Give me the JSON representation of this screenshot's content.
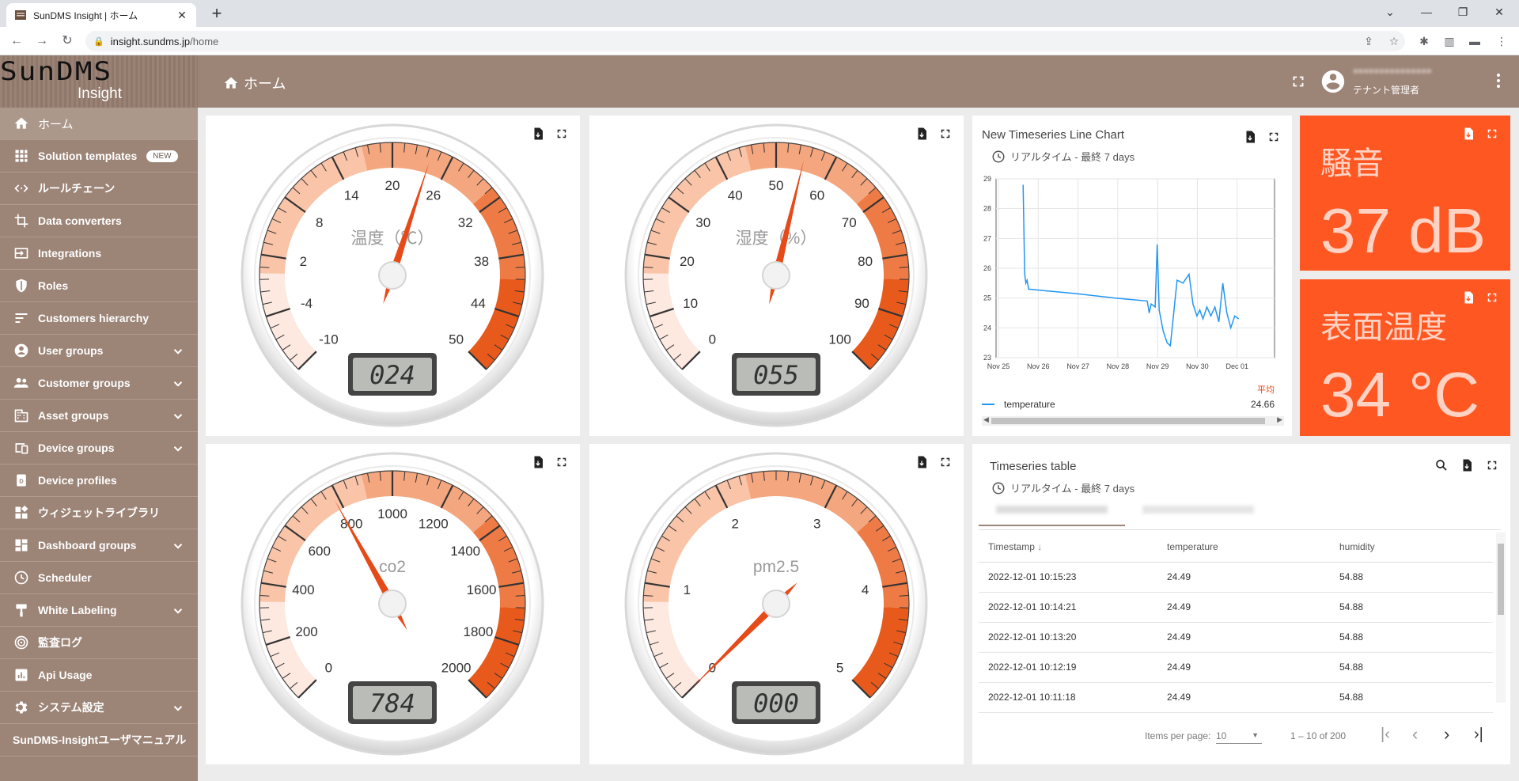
{
  "browser": {
    "tab_title": "SunDMS Insight | ホーム",
    "url_host": "insight.sundms.jp",
    "url_path": "/home"
  },
  "logo": {
    "main": "SunDMS",
    "sub": "Insight"
  },
  "sidebar": {
    "items": [
      {
        "label": "ホーム",
        "icon": "home-icon"
      },
      {
        "label": "Solution templates",
        "icon": "grid-icon",
        "badge": "NEW"
      },
      {
        "label": "ルールチェーン",
        "icon": "code-icon"
      },
      {
        "label": "Data converters",
        "icon": "crop-icon"
      },
      {
        "label": "Integrations",
        "icon": "input-icon"
      },
      {
        "label": "Roles",
        "icon": "shield-icon"
      },
      {
        "label": "Customers hierarchy",
        "icon": "sort-icon"
      },
      {
        "label": "User groups",
        "icon": "account-icon",
        "chevron": true
      },
      {
        "label": "Customer groups",
        "icon": "people-icon",
        "chevron": true
      },
      {
        "label": "Asset groups",
        "icon": "building-icon",
        "chevron": true
      },
      {
        "label": "Device groups",
        "icon": "devices-icon",
        "chevron": true
      },
      {
        "label": "Device profiles",
        "icon": "profile-icon"
      },
      {
        "label": "ウィジェットライブラリ",
        "icon": "widgets-icon"
      },
      {
        "label": "Dashboard groups",
        "icon": "dashboard-icon",
        "chevron": true
      },
      {
        "label": "Scheduler",
        "icon": "clock-icon"
      },
      {
        "label": "White Labeling",
        "icon": "brush-icon",
        "chevron": true
      },
      {
        "label": "監査ログ",
        "icon": "track-icon"
      },
      {
        "label": "Api Usage",
        "icon": "chart-icon"
      },
      {
        "label": "システム設定",
        "icon": "gear-icon",
        "chevron": true
      },
      {
        "label": "SunDMS-Insightユーザマニュアル",
        "icon": ""
      }
    ]
  },
  "topbar": {
    "breadcrumb": "ホーム",
    "user_role": "テナント管理者"
  },
  "gauges": [
    {
      "title": "温度（℃）",
      "min": -10,
      "max": 50,
      "ticks": [
        -10,
        -4,
        2,
        8,
        14,
        20,
        26,
        32,
        38,
        44,
        50
      ],
      "value": 24,
      "display": "024"
    },
    {
      "title": "湿度（%）",
      "min": 0,
      "max": 100,
      "ticks": [
        0,
        10,
        20,
        30,
        40,
        50,
        60,
        70,
        80,
        90,
        100
      ],
      "value": 55,
      "display": "055"
    },
    {
      "title": "co2",
      "min": 0,
      "max": 2000,
      "ticks": [
        0,
        200,
        400,
        600,
        800,
        1000,
        1200,
        1400,
        1600,
        1800,
        2000
      ],
      "value": 784,
      "display": "784"
    },
    {
      "title": "pm2.5",
      "min": 0,
      "max": 5,
      "ticks": [
        0,
        1,
        2,
        3,
        4,
        5
      ],
      "value": 0,
      "display": "000"
    }
  ],
  "line_chart": {
    "title": "New Timeseries Line Chart",
    "timewindow": "リアルタイム - 最終 7 days",
    "avg_label": "平均",
    "legend_name": "temperature",
    "legend_avg": "24.66"
  },
  "chart_data": {
    "type": "line",
    "x_labels": [
      "Nov 25",
      "Nov 26",
      "Nov 27",
      "Nov 28",
      "Nov 29",
      "Nov 30",
      "Dec 01"
    ],
    "ylim": [
      23,
      29
    ],
    "yticks": [
      23,
      24,
      25,
      26,
      27,
      28,
      29
    ],
    "grid": true,
    "legend": "bottom",
    "series": [
      {
        "name": "temperature",
        "color": "#2196f3",
        "points": [
          [
            0.68,
            28.8
          ],
          [
            0.72,
            25.8
          ],
          [
            0.75,
            25.5
          ],
          [
            0.78,
            25.6
          ],
          [
            0.82,
            25.3
          ],
          [
            1.2,
            25.25
          ],
          [
            2.0,
            25.15
          ],
          [
            3.0,
            25.0
          ],
          [
            3.8,
            24.9
          ],
          [
            3.85,
            24.5
          ],
          [
            3.9,
            24.8
          ],
          [
            4.0,
            24.7
          ],
          [
            4.05,
            26.8
          ],
          [
            4.1,
            24.6
          ],
          [
            4.2,
            23.9
          ],
          [
            4.3,
            23.5
          ],
          [
            4.38,
            23.4
          ],
          [
            4.45,
            24.3
          ],
          [
            4.55,
            25.6
          ],
          [
            4.7,
            25.5
          ],
          [
            4.85,
            25.8
          ],
          [
            4.95,
            24.8
          ],
          [
            5.05,
            24.4
          ],
          [
            5.12,
            24.6
          ],
          [
            5.2,
            24.3
          ],
          [
            5.3,
            24.7
          ],
          [
            5.4,
            24.4
          ],
          [
            5.5,
            24.7
          ],
          [
            5.6,
            24.2
          ],
          [
            5.7,
            25.5
          ],
          [
            5.8,
            24.5
          ],
          [
            5.9,
            24.0
          ],
          [
            6.0,
            24.4
          ],
          [
            6.1,
            24.3
          ]
        ]
      }
    ]
  },
  "noise": {
    "title": "騒音",
    "value": "37 dB"
  },
  "surface_temp": {
    "title": "表面温度",
    "value": "34 °C"
  },
  "ts_table": {
    "title": "Timeseries table",
    "timewindow": "リアルタイム - 最終 7 days",
    "columns": [
      "Timestamp",
      "temperature",
      "humidity"
    ],
    "rows": [
      [
        "2022-12-01 10:15:23",
        "24.49",
        "54.88"
      ],
      [
        "2022-12-01 10:14:21",
        "24.49",
        "54.88"
      ],
      [
        "2022-12-01 10:13:20",
        "24.49",
        "54.88"
      ],
      [
        "2022-12-01 10:12:19",
        "24.49",
        "54.88"
      ],
      [
        "2022-12-01 10:11:18",
        "24.49",
        "54.88"
      ]
    ],
    "items_per_page_label": "Items per page:",
    "items_per_page": "10",
    "range": "1 – 10 of 200"
  },
  "colors": {
    "brand": "#9c8477",
    "accent": "#ff5722",
    "line": "#2196f3"
  }
}
